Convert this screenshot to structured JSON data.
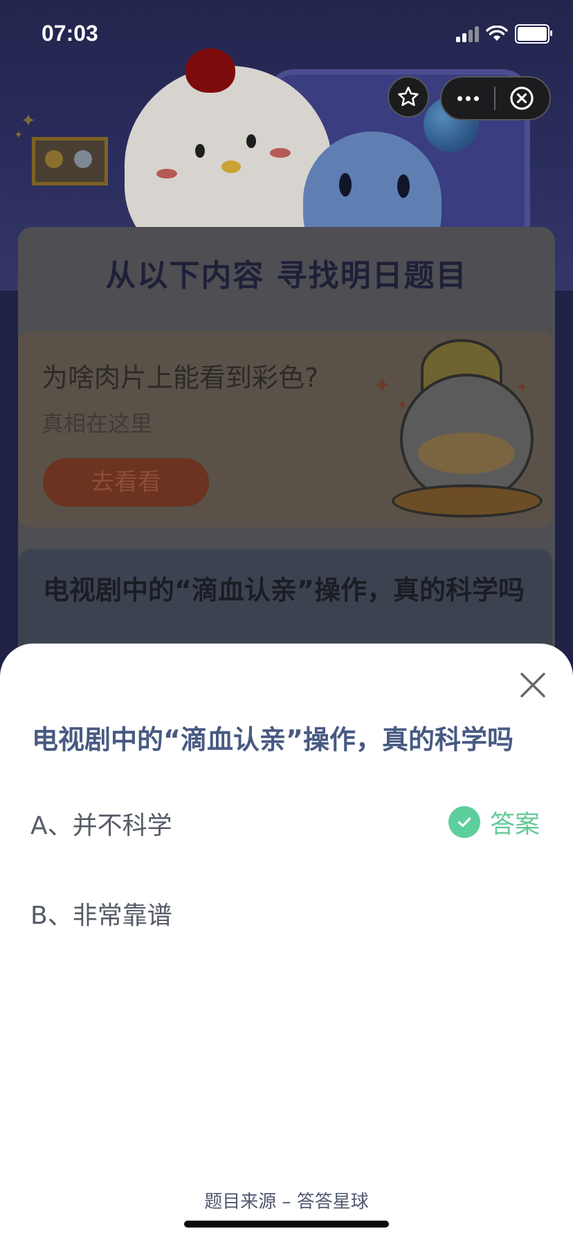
{
  "status_bar": {
    "time": "07:03",
    "icons": [
      "signal-icon",
      "wifi-icon",
      "battery-icon"
    ]
  },
  "capsule": {
    "icons": [
      "star-icon",
      "more-icon",
      "close-circle-icon"
    ]
  },
  "background": {
    "heading": "从以下内容 寻找明日题目",
    "article": {
      "title": "为啥肉片上能看到彩色?",
      "subtitle": "真相在这里",
      "button_label": "去看看"
    },
    "question_card": {
      "title": "电视剧中的“滴血认亲”操作，真的科学吗"
    }
  },
  "sheet": {
    "question": "电视剧中的“滴血认亲”操作，真的科学吗",
    "options": [
      {
        "label": "A、并不科学",
        "is_answer": true
      },
      {
        "label": "B、非常靠谱",
        "is_answer": false
      }
    ],
    "answer_label": "答案",
    "footer": "题目来源 – 答答星球",
    "colors": {
      "question": "#485a82",
      "answer": "#5dcf9c"
    }
  }
}
